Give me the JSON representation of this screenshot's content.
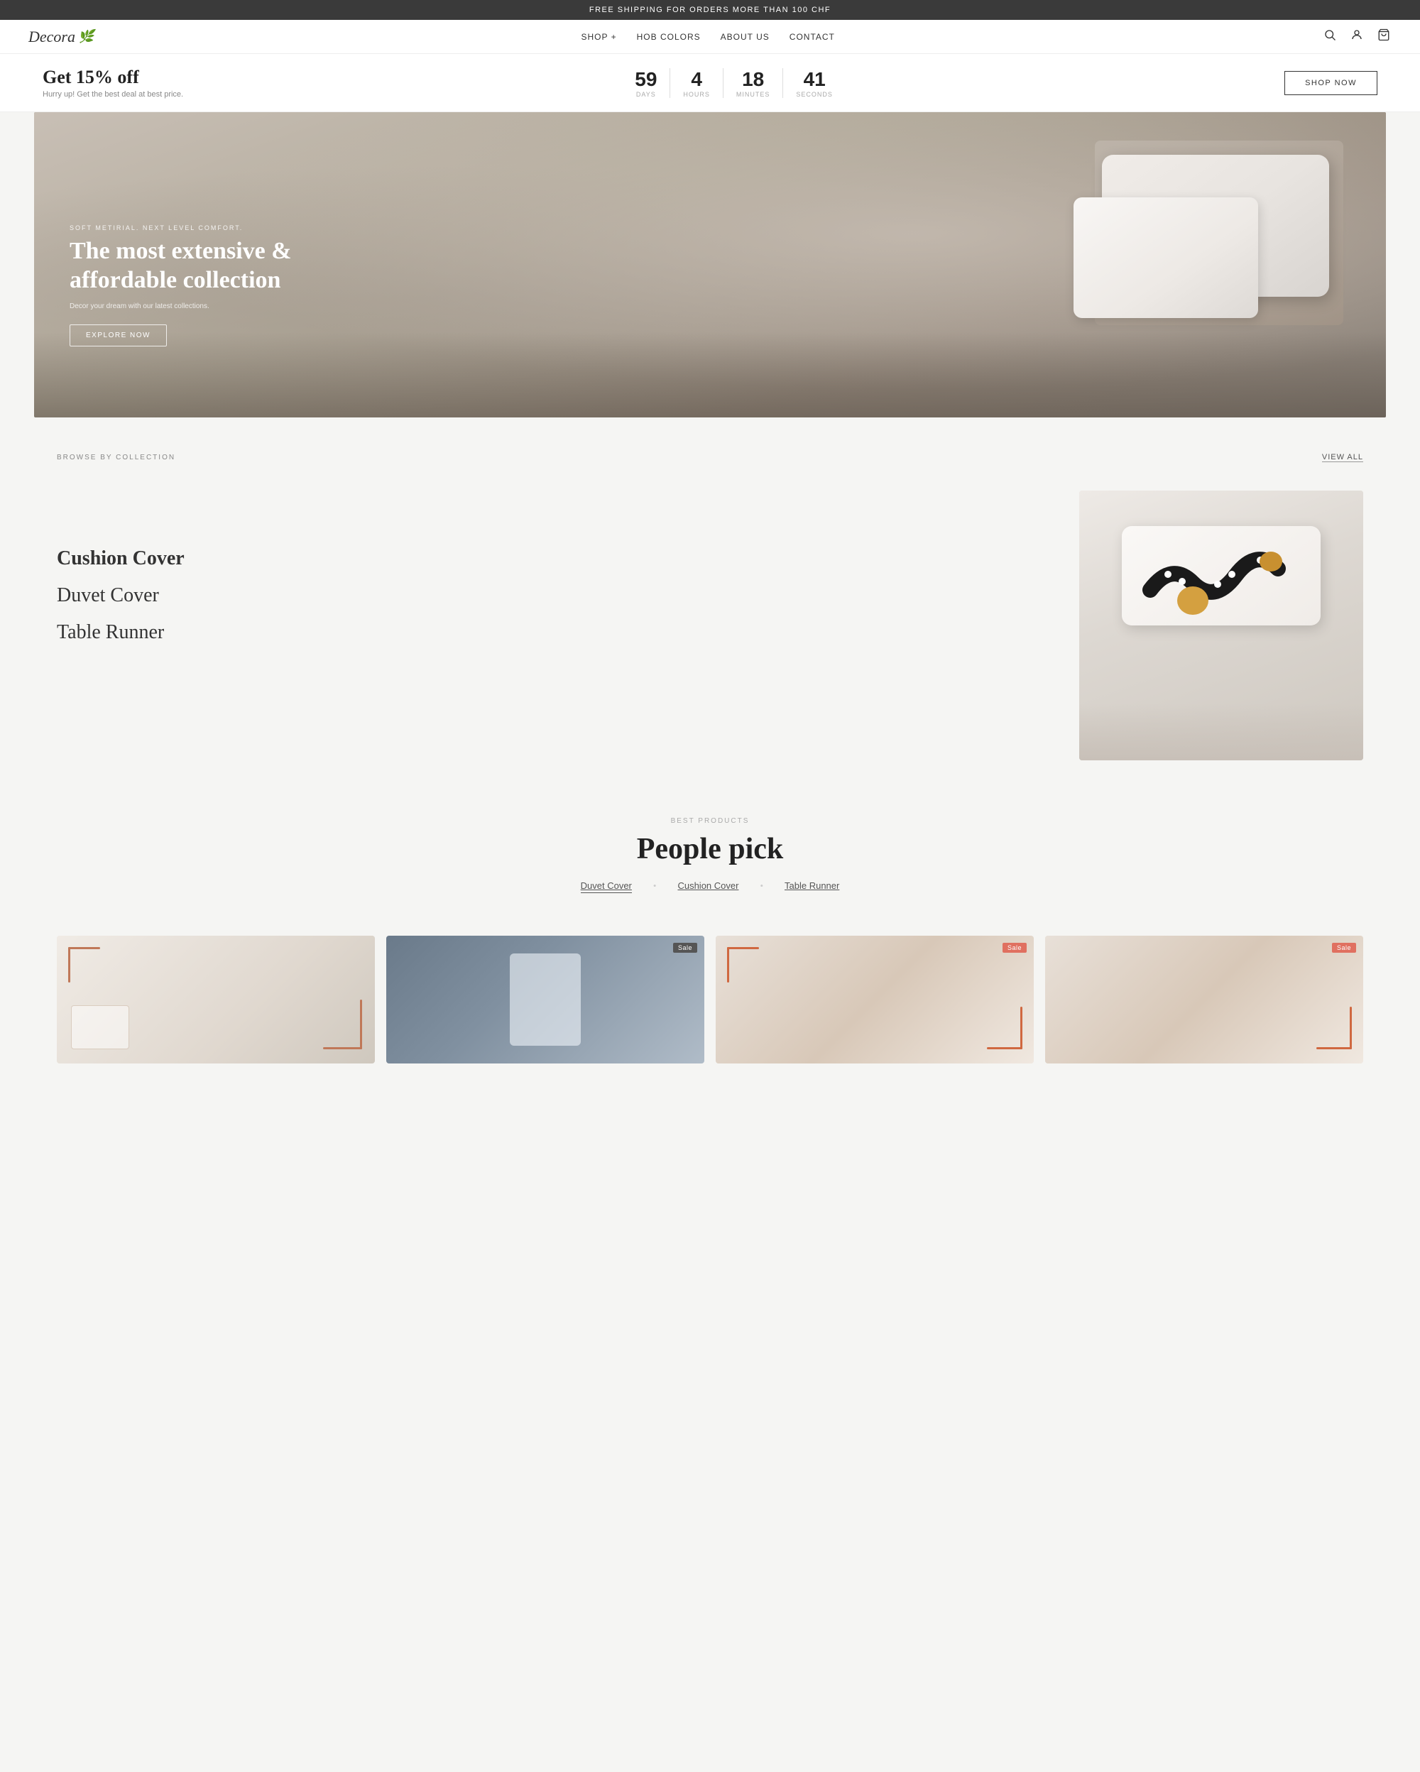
{
  "announcement": {
    "text": "FREE SHIPPING FOR ORDERS MORE THAN 100 CHF"
  },
  "header": {
    "logo": "Decora",
    "nav": [
      {
        "label": "SHOP +",
        "id": "shop"
      },
      {
        "label": "HOB COLORS",
        "id": "hob-colors"
      },
      {
        "label": "ABOUT US",
        "id": "about-us"
      },
      {
        "label": "CONTACT",
        "id": "contact"
      }
    ]
  },
  "promo": {
    "heading": "Get 15% off",
    "subtext": "Hurry up! Get the best deal at best price.",
    "countdown": {
      "days": {
        "value": "59",
        "label": "DAYS"
      },
      "hours": {
        "value": "4",
        "label": "HOURS"
      },
      "minutes": {
        "value": "18",
        "label": "MINUTES"
      },
      "seconds": {
        "value": "41",
        "label": "SECONDS"
      }
    },
    "cta": "SHOP NOW"
  },
  "hero": {
    "eyebrow": "SOFT METIRIAL. NEXT LEVEL COMFORT.",
    "title": "The most extensive & affordable collection",
    "description": "Decor your dream with our latest collections.",
    "cta": "EXPLORE NOW"
  },
  "browse": {
    "label": "BROWSE BY COLLECTION",
    "view_all": "VIEW ALL",
    "categories": [
      {
        "label": "Cushion Cover",
        "active": true
      },
      {
        "label": "Duvet Cover",
        "active": false
      },
      {
        "label": "Table Runner",
        "active": false
      }
    ]
  },
  "best_products": {
    "eyebrow": "BEST PRODUCTS",
    "title": "People pick",
    "tabs": [
      {
        "label": "Duvet Cover",
        "active": true
      },
      {
        "label": "Cushion Cover",
        "active": false
      },
      {
        "label": "Table Runner",
        "active": false
      }
    ],
    "products": [
      {
        "id": 1,
        "sale": false,
        "img_class": "product-img-1"
      },
      {
        "id": 2,
        "sale": true,
        "img_class": "product-img-2"
      },
      {
        "id": 3,
        "sale": true,
        "img_class": "product-img-3"
      },
      {
        "id": 4,
        "sale": true,
        "img_class": "product-img-4"
      }
    ]
  }
}
